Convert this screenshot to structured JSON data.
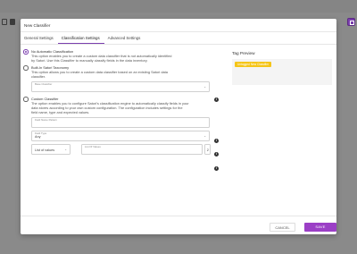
{
  "modal": {
    "title": "New Classifier",
    "tabs": [
      {
        "label": "General Settings"
      },
      {
        "label": "Classification Settings"
      },
      {
        "label": "Advanced Settings"
      }
    ],
    "active_tab": "Classification Settings"
  },
  "options": {
    "no_auto": {
      "title": "No Automatic Classification",
      "desc1": "This option enables you to create a custom data classifier that is not automatically identified",
      "desc2": "by Satori. Use this Classifier to manually classify fields in the data inventory.",
      "selected": true
    },
    "builtin": {
      "title": "Built-In Satori Taxonomy",
      "desc1": "This option allows you to create a custom data classifier based on an existing Satori data",
      "desc2": "classifier.",
      "field_label": "Base Classifier"
    },
    "custom": {
      "title": "Custom Classifier",
      "desc1": "The option enables you to configure Satori's classification engine to automatically classify fields in your",
      "desc2": "data stores according to your own custom configuration. The configuration includes settings for the",
      "desc3": "field name, type and expected values.",
      "field_name_label": "Field Name Pattern",
      "field_type_label": "Field Type",
      "field_type_value": "Any",
      "values_select": "List of values",
      "values_field_label": "List Of Values",
      "values_count": "2"
    }
  },
  "tag_preview": {
    "label": "Tag Preview",
    "chip": "Untagged New Classifier"
  },
  "footer": {
    "cancel": "CANCEL",
    "save": "SAVE"
  },
  "colors": {
    "accent": "#7b3fae",
    "save_button": "#9b3fc6",
    "tag_chip": "#f5c518"
  }
}
